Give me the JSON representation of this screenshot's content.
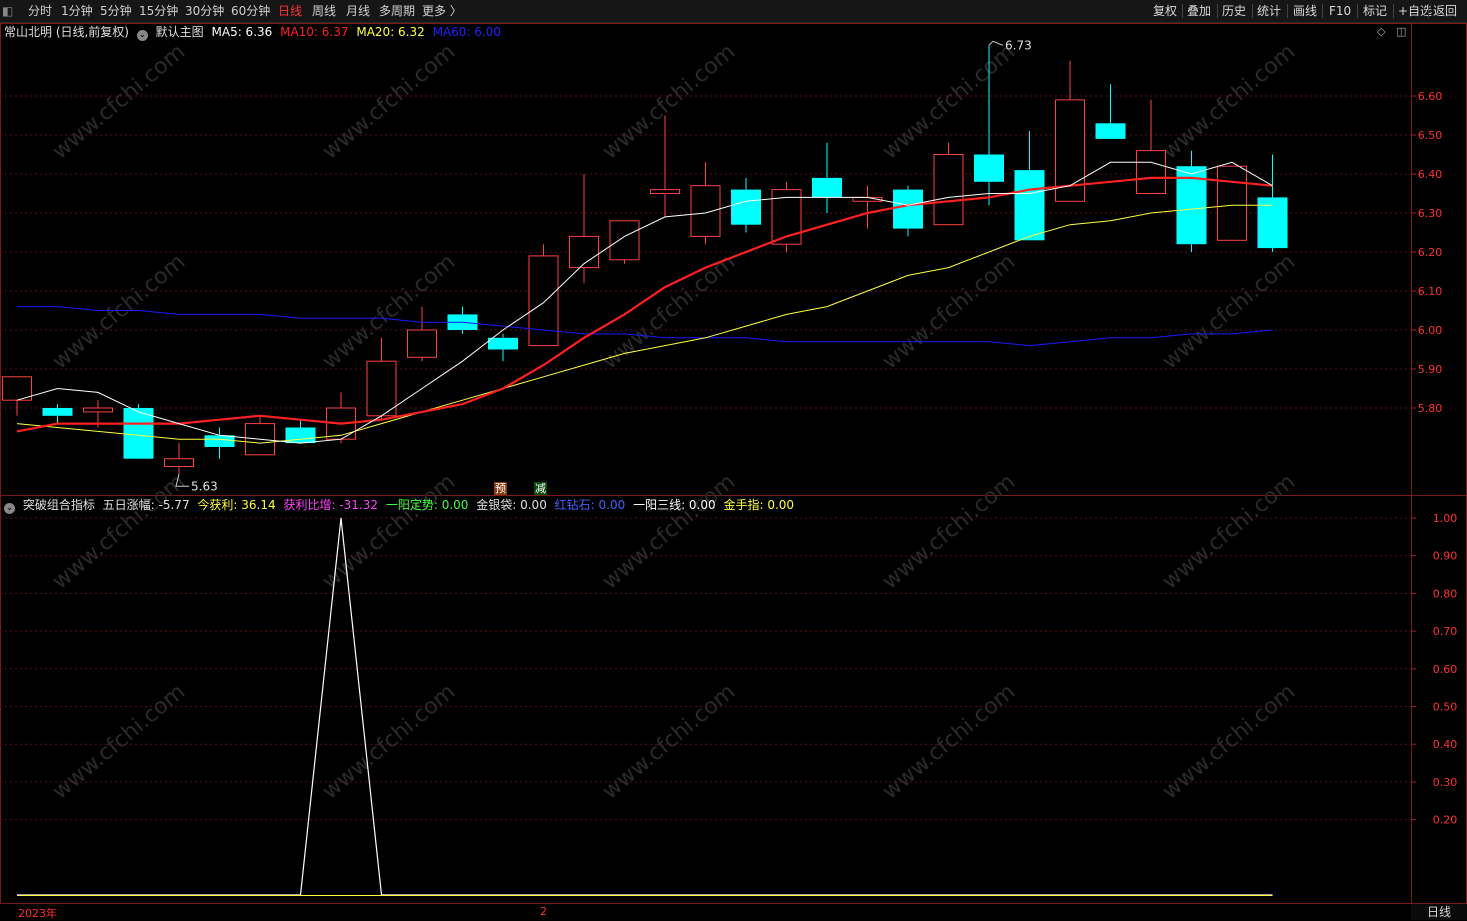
{
  "toolbar": {
    "left_items": [
      "分时",
      "1分钟",
      "5分钟",
      "15分钟",
      "30分钟",
      "60分钟",
      "日线",
      "周线",
      "月线",
      "多周期",
      "更多 〉"
    ],
    "active": "日线",
    "right_items": [
      "复权",
      "叠加",
      "历史",
      "统计",
      "画线",
      "F10",
      "标记",
      "+自选",
      "返回"
    ]
  },
  "main_panel": {
    "stock_title": "常山北明 (日线,前复权)",
    "template": "默认主图",
    "ma": [
      {
        "label": "MA5: 6.36",
        "color": "#ffffff"
      },
      {
        "label": "MA10: 6.37",
        "color": "#ff2020"
      },
      {
        "label": "MA20: 6.32",
        "color": "#ffff40"
      },
      {
        "label": "MA60: 6.00",
        "color": "#2020ff"
      }
    ],
    "high_label": "6.73",
    "low_label": "5.63",
    "price_ticks": [
      "6.60",
      "6.50",
      "6.40",
      "6.30",
      "6.20",
      "6.10",
      "6.00",
      "5.90",
      "5.80"
    ]
  },
  "signals": [
    {
      "text": "预",
      "bg": "#8a3a10",
      "color": "#ffffff"
    },
    {
      "text": "减",
      "bg": "#0a4a0a",
      "color": "#ffffff"
    }
  ],
  "sub_panel": {
    "title": "突破组合指标",
    "values": [
      {
        "label": "五日涨幅: -5.77",
        "color": "#e0e0e0"
      },
      {
        "label": "今获利: 36.14",
        "color": "#ffff40"
      },
      {
        "label": "获利比增: -31.32",
        "color": "#ff40ff"
      },
      {
        "label": "一阳定势: 0.00",
        "color": "#40ff40"
      },
      {
        "label": "金银袋: 0.00",
        "color": "#e0e0e0"
      },
      {
        "label": "红钻石: 0.00",
        "color": "#4060ff"
      },
      {
        "label": "一阳三线: 0.00",
        "color": "#ffffff"
      },
      {
        "label": "金手指: 0.00",
        "color": "#ffff40"
      }
    ],
    "ticks": [
      "1.00",
      "0.90",
      "0.80",
      "0.70",
      "0.60",
      "0.50",
      "0.40",
      "0.30",
      "0.20"
    ]
  },
  "date_axis": [
    "2023年",
    "2"
  ],
  "period": "日线",
  "watermark": "www.cfchi.com",
  "chart_data": {
    "type": "candlestick",
    "candles": [
      {
        "o": 5.82,
        "h": 5.85,
        "l": 5.78,
        "c": 5.88
      },
      {
        "o": 5.8,
        "h": 5.81,
        "l": 5.76,
        "c": 5.78
      },
      {
        "o": 5.79,
        "h": 5.82,
        "l": 5.75,
        "c": 5.8
      },
      {
        "o": 5.8,
        "h": 5.81,
        "l": 5.7,
        "c": 5.67
      },
      {
        "o": 5.65,
        "h": 5.71,
        "l": 5.63,
        "c": 5.67
      },
      {
        "o": 5.73,
        "h": 5.75,
        "l": 5.67,
        "c": 5.7
      },
      {
        "o": 5.68,
        "h": 5.78,
        "l": 5.68,
        "c": 5.76
      },
      {
        "o": 5.75,
        "h": 5.77,
        "l": 5.72,
        "c": 5.71
      },
      {
        "o": 5.72,
        "h": 5.84,
        "l": 5.71,
        "c": 5.8
      },
      {
        "o": 5.78,
        "h": 5.98,
        "l": 5.77,
        "c": 5.92
      },
      {
        "o": 5.93,
        "h": 6.06,
        "l": 5.92,
        "c": 6.0
      },
      {
        "o": 6.04,
        "h": 6.06,
        "l": 5.99,
        "c": 6.0
      },
      {
        "o": 5.98,
        "h": 5.99,
        "l": 5.92,
        "c": 5.95
      },
      {
        "o": 5.96,
        "h": 6.22,
        "l": 5.96,
        "c": 6.19
      },
      {
        "o": 6.16,
        "h": 6.4,
        "l": 6.12,
        "c": 6.24
      },
      {
        "o": 6.18,
        "h": 6.28,
        "l": 6.17,
        "c": 6.28
      },
      {
        "o": 6.35,
        "h": 6.55,
        "l": 6.29,
        "c": 6.36
      },
      {
        "o": 6.24,
        "h": 6.43,
        "l": 6.22,
        "c": 6.37
      },
      {
        "o": 6.36,
        "h": 6.39,
        "l": 6.25,
        "c": 6.27
      },
      {
        "o": 6.22,
        "h": 6.38,
        "l": 6.2,
        "c": 6.36
      },
      {
        "o": 6.39,
        "h": 6.48,
        "l": 6.3,
        "c": 6.34
      },
      {
        "o": 6.33,
        "h": 6.37,
        "l": 6.26,
        "c": 6.34
      },
      {
        "o": 6.36,
        "h": 6.37,
        "l": 6.24,
        "c": 6.26
      },
      {
        "o": 6.27,
        "h": 6.48,
        "l": 6.27,
        "c": 6.45
      },
      {
        "o": 6.45,
        "h": 6.73,
        "l": 6.32,
        "c": 6.38
      },
      {
        "o": 6.41,
        "h": 6.51,
        "l": 6.23,
        "c": 6.23
      },
      {
        "o": 6.33,
        "h": 6.69,
        "l": 6.33,
        "c": 6.59
      },
      {
        "o": 6.53,
        "h": 6.63,
        "l": 6.49,
        "c": 6.49
      },
      {
        "o": 6.35,
        "h": 6.59,
        "l": 6.35,
        "c": 6.46
      },
      {
        "o": 6.42,
        "h": 6.46,
        "l": 6.2,
        "c": 6.22
      },
      {
        "o": 6.23,
        "h": 6.42,
        "l": 6.23,
        "c": 6.42
      },
      {
        "o": 6.34,
        "h": 6.45,
        "l": 6.2,
        "c": 6.21
      }
    ],
    "ma5": [
      5.82,
      5.85,
      5.84,
      5.79,
      5.76,
      5.73,
      5.72,
      5.71,
      5.72,
      5.78,
      5.85,
      5.92,
      6.0,
      6.07,
      6.17,
      6.24,
      6.29,
      6.3,
      6.33,
      6.34,
      6.34,
      6.34,
      6.32,
      6.34,
      6.35,
      6.35,
      6.37,
      6.43,
      6.43,
      6.4,
      6.43,
      6.37
    ],
    "ma10": [
      5.74,
      5.76,
      5.76,
      5.76,
      5.76,
      5.77,
      5.78,
      5.77,
      5.76,
      5.77,
      5.79,
      5.81,
      5.85,
      5.91,
      5.98,
      6.04,
      6.11,
      6.16,
      6.2,
      6.24,
      6.27,
      6.3,
      6.32,
      6.33,
      6.34,
      6.36,
      6.37,
      6.38,
      6.39,
      6.39,
      6.38,
      6.37
    ],
    "ma20": [
      5.76,
      5.75,
      5.74,
      5.73,
      5.72,
      5.72,
      5.71,
      5.72,
      5.73,
      5.76,
      5.79,
      5.82,
      5.85,
      5.88,
      5.91,
      5.94,
      5.96,
      5.98,
      6.01,
      6.04,
      6.06,
      6.1,
      6.14,
      6.16,
      6.2,
      6.24,
      6.27,
      6.28,
      6.3,
      6.31,
      6.32,
      6.32
    ],
    "ma60": [
      6.06,
      6.06,
      6.05,
      6.05,
      6.04,
      6.04,
      6.04,
      6.03,
      6.03,
      6.03,
      6.02,
      6.02,
      6.01,
      6.0,
      5.99,
      5.99,
      5.98,
      5.98,
      5.98,
      5.97,
      5.97,
      5.97,
      5.97,
      5.97,
      5.97,
      5.96,
      5.97,
      5.98,
      5.98,
      5.99,
      5.99,
      6.0
    ],
    "indicator": [
      0,
      0,
      0,
      0,
      0,
      0,
      0,
      0,
      1,
      0,
      0,
      0,
      0,
      0,
      0,
      0,
      0,
      0,
      0,
      0,
      0,
      0,
      0,
      0,
      0,
      0,
      0,
      0,
      0,
      0,
      0,
      0
    ],
    "price_range": [
      5.63,
      6.73
    ],
    "indicator_range": [
      0,
      1
    ]
  }
}
